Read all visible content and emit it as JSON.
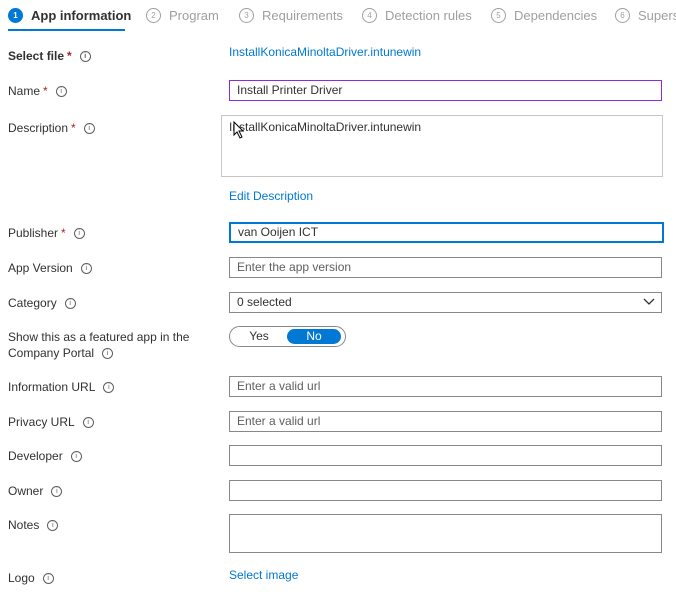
{
  "tabs": [
    {
      "num": "1",
      "label": "App information",
      "active": true
    },
    {
      "num": "2",
      "label": "Program"
    },
    {
      "num": "3",
      "label": "Requirements"
    },
    {
      "num": "4",
      "label": "Detection rules"
    },
    {
      "num": "5",
      "label": "Dependencies"
    },
    {
      "num": "6",
      "label": "Supers"
    }
  ],
  "fields": {
    "select_file": {
      "label": "Select file",
      "value": "InstallKonicaMinoltaDriver.intunewin"
    },
    "name": {
      "label": "Name",
      "value": "Install Printer Driver"
    },
    "description": {
      "label": "Description",
      "value": "InstallKonicaMinoltaDriver.intunewin",
      "edit_link": "Edit Description"
    },
    "publisher": {
      "label": "Publisher",
      "value": "van Ooijen ICT"
    },
    "app_version": {
      "label": "App Version",
      "placeholder": "Enter the app version"
    },
    "category": {
      "label": "Category",
      "value": "0 selected"
    },
    "featured": {
      "label": "Show this as a featured app in the Company Portal",
      "yes": "Yes",
      "no": "No",
      "selected": "No"
    },
    "information_url": {
      "label": "Information URL",
      "placeholder": "Enter a valid url"
    },
    "privacy_url": {
      "label": "Privacy URL",
      "placeholder": "Enter a valid url"
    },
    "developer": {
      "label": "Developer",
      "value": ""
    },
    "owner": {
      "label": "Owner",
      "value": ""
    },
    "notes": {
      "label": "Notes",
      "value": ""
    },
    "logo": {
      "label": "Logo",
      "link": "Select image"
    }
  },
  "required_mark": "*",
  "info_glyph": "i",
  "colors": {
    "accent": "#0078d4",
    "required": "#a4262c",
    "focus_border": "#8a2be2"
  }
}
